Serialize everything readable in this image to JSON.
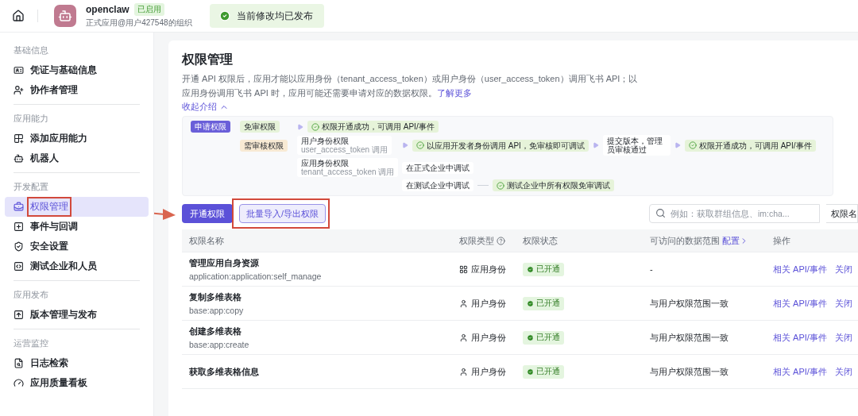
{
  "topbar": {
    "app_name": "openclaw",
    "app_badge": "已启用",
    "app_subtitle": "正式应用@用户427548的组织",
    "toast": "当前修改均已发布"
  },
  "sidebar": [
    {
      "title": "基础信息",
      "items": [
        {
          "label": "凭证与基础信息",
          "selected": false
        },
        {
          "label": "协作者管理",
          "selected": false
        }
      ]
    },
    {
      "title": "应用能力",
      "items": [
        {
          "label": "添加应用能力",
          "selected": false
        },
        {
          "label": "机器人",
          "selected": false
        }
      ]
    },
    {
      "title": "开发配置",
      "items": [
        {
          "label": "权限管理",
          "selected": true,
          "highlighted": true
        },
        {
          "label": "事件与回调",
          "selected": false
        },
        {
          "label": "安全设置",
          "selected": false
        },
        {
          "label": "测试企业和人员",
          "selected": false
        }
      ]
    },
    {
      "title": "应用发布",
      "items": [
        {
          "label": "版本管理与发布",
          "selected": false
        }
      ]
    },
    {
      "title": "运营监控",
      "items": [
        {
          "label": "日志检索",
          "selected": false
        },
        {
          "label": "应用质量看板",
          "selected": false
        }
      ]
    }
  ],
  "page": {
    "title": "权限管理",
    "intro": "开通 API 权限后，应用才能以应用身份（tenant_access_token）或用户身份（user_access_token）调用飞书 API；以应用身份调用飞书 API 时，应用可能还需要申请对应的数据权限。",
    "intro_link": "了解更多",
    "collapse": "收起介绍",
    "intro_expanded": true
  },
  "flow": {
    "start": "申请权限",
    "free": {
      "tag": "免审权限",
      "steps": [
        {
          "kind": "success",
          "text": "权限开通成功，可调用 API/事件"
        }
      ]
    },
    "review": {
      "tag": "需审核权限",
      "paths": [
        {
          "label": "用户身份权限",
          "note": "user_access_token 调用",
          "steps": [
            {
              "kind": "success",
              "text": "以应用开发者身份调用 API，免审核即可调试"
            },
            {
              "kind": "step",
              "text": "提交版本，管理员审核通过"
            },
            {
              "kind": "success",
              "text": "权限开通成功，可调用 API/事件"
            }
          ]
        },
        {
          "label": "应用身份权限",
          "note": "tenant_access_token 调用",
          "envs": [
            {
              "text": "在正式企业中调试"
            },
            {
              "text": "在测试企业中调试",
              "steps": [
                {
                  "kind": "success",
                  "text": "测试企业中所有权限免审调试"
                }
              ]
            }
          ]
        }
      ]
    }
  },
  "toolbar": {
    "primary": "开通权限",
    "secondary": "批量导入/导出权限",
    "secondary_highlighted": true,
    "annotation_arrow": true,
    "search_placeholder": "例如：获取群组信息、im:cha...",
    "filter": "权限名"
  },
  "table": {
    "columns": [
      {
        "label": "权限名称",
        "help": false
      },
      {
        "label": "权限类型",
        "help": true
      },
      {
        "label": "权限状态",
        "help": false
      },
      {
        "label": "可访问的数据范围",
        "help": false,
        "link": "配置"
      },
      {
        "label": "操作",
        "help": false
      }
    ],
    "rows": [
      {
        "name": "管理应用自身资源",
        "code": "application:application:self_manage",
        "type": "应用身份",
        "kind": "app",
        "status": "已开通",
        "scope": "-",
        "actions": [
          "相关 API/事件",
          "关闭"
        ]
      },
      {
        "name": "复制多维表格",
        "code": "base:app:copy",
        "type": "用户身份",
        "kind": "user",
        "status": "已开通",
        "scope": "与用户权限范围一致",
        "actions": [
          "相关 API/事件",
          "关闭"
        ]
      },
      {
        "name": "创建多维表格",
        "code": "base:app:create",
        "type": "用户身份",
        "kind": "user",
        "status": "已开通",
        "scope": "与用户权限范围一致",
        "actions": [
          "相关 API/事件",
          "关闭"
        ]
      },
      {
        "name": "获取多维表格信息",
        "type": "用户身份",
        "kind": "user",
        "status": "已开通",
        "scope": "与用户权限范围一致",
        "actions": [
          "相关 API/事件",
          "关闭"
        ]
      }
    ]
  }
}
